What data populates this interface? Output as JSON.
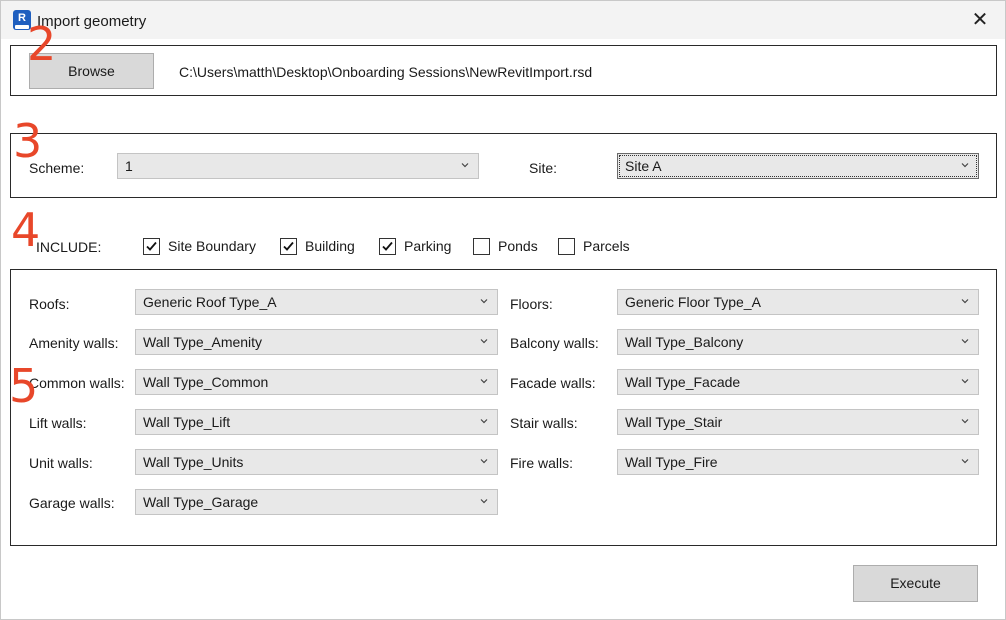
{
  "window": {
    "title": "Import geometry",
    "app_icon_letter": "R",
    "close_glyph": "✕"
  },
  "file": {
    "browse_label": "Browse",
    "path": "C:\\Users\\matth\\Desktop\\Onboarding Sessions\\NewRevitImport.rsd"
  },
  "scheme_site": {
    "scheme_label": "Scheme:",
    "scheme_value": "1",
    "site_label": "Site:",
    "site_value": "Site A"
  },
  "include": {
    "label": "INCLUDE:",
    "options": [
      {
        "label": "Site Boundary",
        "checked": true
      },
      {
        "label": "Building",
        "checked": true
      },
      {
        "label": "Parking",
        "checked": true
      },
      {
        "label": "Ponds",
        "checked": false
      },
      {
        "label": "Parcels",
        "checked": false
      }
    ]
  },
  "types": {
    "roofs_label": "Roofs:",
    "roofs_value": "Generic Roof Type_A",
    "floors_label": "Floors:",
    "floors_value": "Generic Floor Type_A",
    "amenity_label": "Amenity walls:",
    "amenity_value": "Wall Type_Amenity",
    "balcony_label": "Balcony walls:",
    "balcony_value": "Wall Type_Balcony",
    "common_label": "Common walls:",
    "common_value": "Wall Type_Common",
    "facade_label": "Facade walls:",
    "facade_value": "Wall Type_Facade",
    "lift_label": "Lift walls:",
    "lift_value": "Wall Type_Lift",
    "stair_label": "Stair walls:",
    "stair_value": "Wall Type_Stair",
    "unit_label": "Unit walls:",
    "unit_value": "Wall Type_Units",
    "fire_label": "Fire walls:",
    "fire_value": "Wall Type_Fire",
    "garage_label": "Garage walls:",
    "garage_value": "Wall Type_Garage"
  },
  "actions": {
    "execute_label": "Execute"
  },
  "markers": {
    "m2": "2",
    "m3": "3",
    "m4": "4",
    "m5": "5"
  },
  "colors": {
    "marker": "#e8472a",
    "app_icon": "#1f5fbf"
  },
  "icons": {
    "dropdown": "chevron-down-icon",
    "check": "check-icon",
    "close": "close-icon"
  }
}
